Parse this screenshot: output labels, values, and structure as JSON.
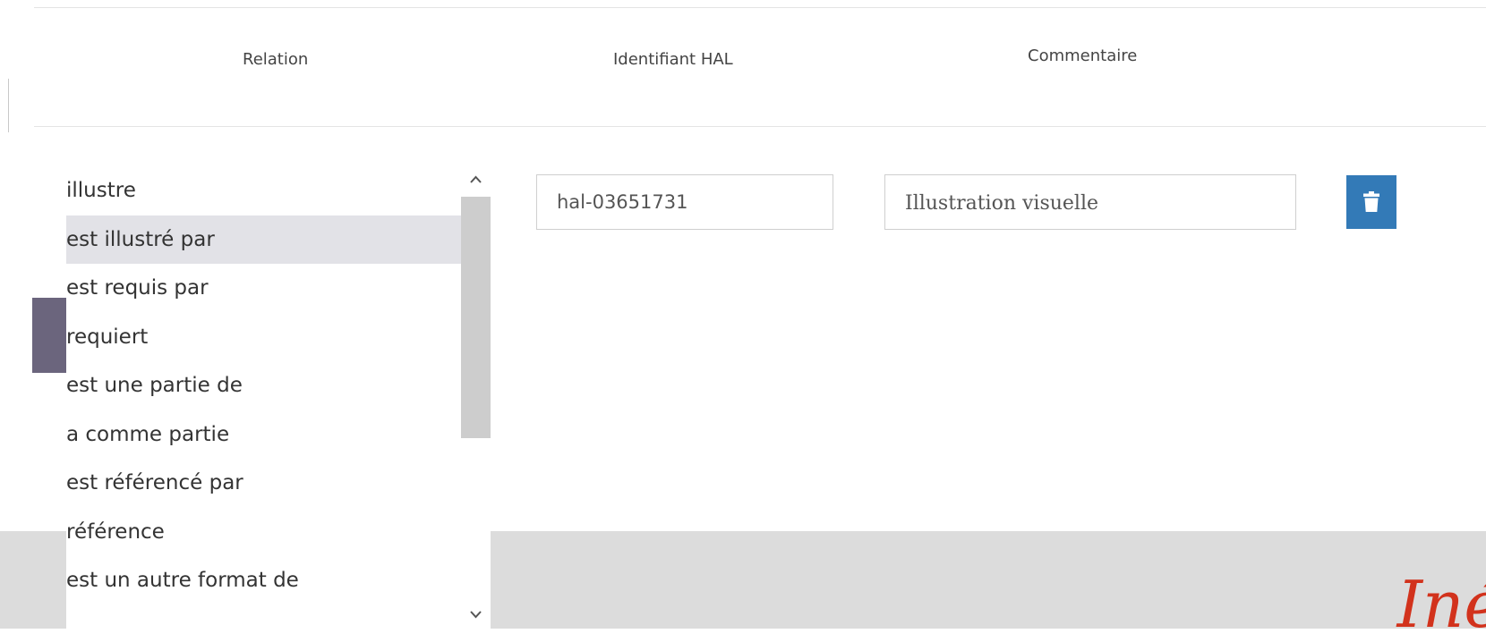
{
  "table_header": {
    "relation": "Relation",
    "identifiant": "Identifiant HAL",
    "commentaire": "Commentaire"
  },
  "relation_select": {
    "options": [
      "illustre",
      "est illustré par",
      "est requis par",
      "requiert",
      "est une partie de",
      "a comme partie",
      "est référencé par",
      "référence",
      "est un autre format de"
    ],
    "selected": "est illustré par"
  },
  "row": {
    "hal_id": "hal-03651731",
    "comment": "Illustration visuelle"
  },
  "icons": {
    "delete": "trash-icon",
    "scroll_up": "chevron-up-icon",
    "scroll_down": "chevron-down-icon"
  },
  "colors": {
    "delete_button": "#337ab7",
    "selected_option": "#e2e2e7",
    "logo": "#d2321c",
    "footer": "#dcdcdc"
  }
}
